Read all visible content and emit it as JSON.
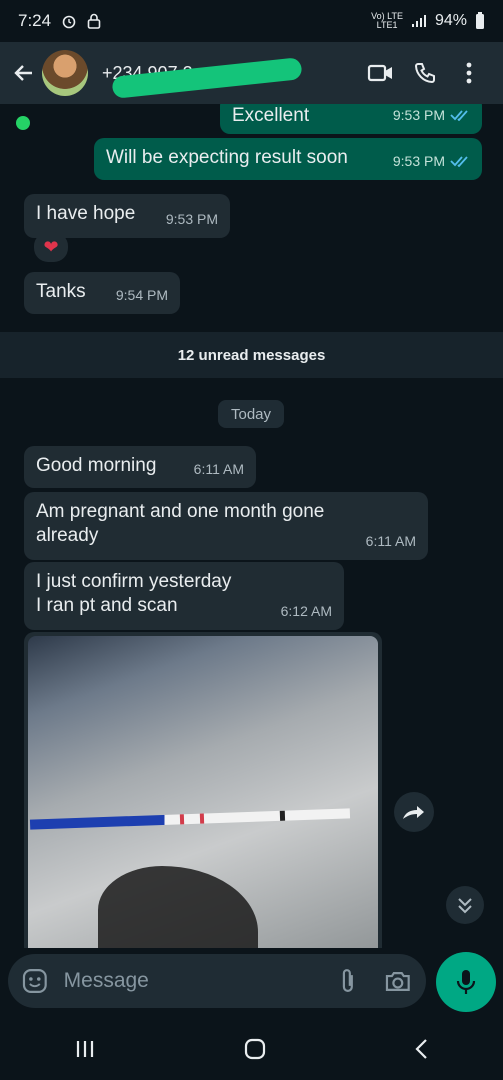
{
  "status_bar": {
    "time": "7:24",
    "network": "Vo) LTE",
    "carrier": "LTE1",
    "battery": "94%"
  },
  "header": {
    "contact_name": "+234 907 2",
    "video_icon": "video-call-icon",
    "call_icon": "phone-icon",
    "menu_icon": "more-vert-icon"
  },
  "messages_before": [
    {
      "text": "Excellent",
      "time": "9:53 PM",
      "dir": "out"
    },
    {
      "text": "Will be expecting result soon",
      "time": "9:53 PM",
      "dir": "out"
    },
    {
      "text": "I have hope",
      "time": "9:53 PM",
      "dir": "in",
      "reaction": "❤"
    },
    {
      "text": "Tanks",
      "time": "9:54 PM",
      "dir": "in"
    }
  ],
  "unread_banner": "12 unread messages",
  "day_label": "Today",
  "messages_after": [
    {
      "text": "Good morning",
      "time": "6:11 AM",
      "dir": "in"
    },
    {
      "line1": "Am pregnant and one month gone",
      "line2": "already",
      "time": "6:11 AM",
      "dir": "in"
    },
    {
      "line1": "I just confirm yesterday",
      "line2": "I ran pt and scan",
      "time": "6:12 AM",
      "dir": "in"
    }
  ],
  "input": {
    "placeholder": "Message"
  },
  "colors": {
    "outgoing": "#005c4b",
    "incoming": "#202c33",
    "accent": "#00a884",
    "tick": "#53bdeb"
  }
}
